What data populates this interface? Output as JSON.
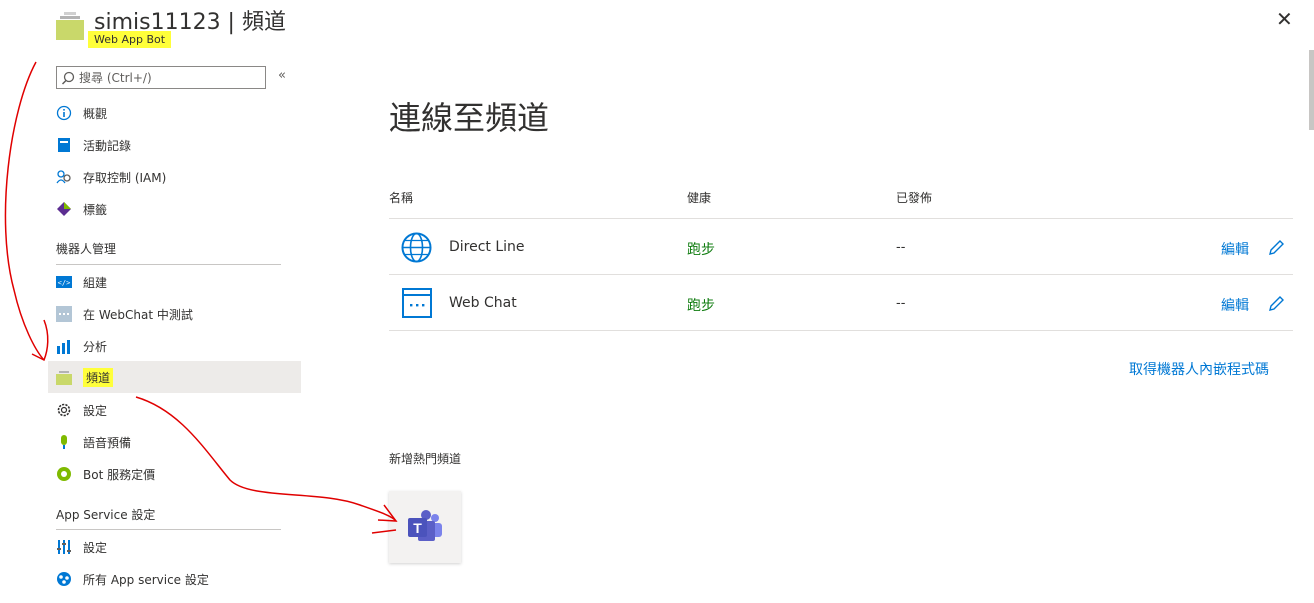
{
  "header": {
    "title": "simis11123 | 頻道",
    "subtitle": "Web App Bot",
    "close_icon": "close-icon"
  },
  "sidebar": {
    "search_placeholder": "搜尋 (Ctrl+/)",
    "collapse_label": "«",
    "items_top": [
      {
        "label": "概觀",
        "icon": "info-icon"
      },
      {
        "label": "活動記錄",
        "icon": "activity-log-icon"
      },
      {
        "label": "存取控制 (IAM)",
        "icon": "people-icon"
      },
      {
        "label": "標籤",
        "icon": "tag-icon"
      }
    ],
    "section_bot": "機器人管理",
    "items_bot": [
      {
        "label": "組建",
        "icon": "code-icon"
      },
      {
        "label": "在 WebChat 中測試",
        "icon": "webchat-test-icon"
      },
      {
        "label": "分析",
        "icon": "analytics-icon"
      },
      {
        "label": "頻道",
        "icon": "channels-icon"
      },
      {
        "label": "設定",
        "icon": "gear-icon"
      },
      {
        "label": "語音預備",
        "icon": "microphone-icon"
      },
      {
        "label": "Bot 服務定價",
        "icon": "pricing-icon"
      }
    ],
    "section_app": "App Service 設定",
    "items_app": [
      {
        "label": "設定",
        "icon": "sliders-icon"
      },
      {
        "label": "所有 App service 設定",
        "icon": "app-service-icon"
      }
    ]
  },
  "main": {
    "title": "連線至頻道",
    "columns": {
      "name": "名稱",
      "health": "健康",
      "published": "已發佈"
    },
    "channels": [
      {
        "name": "Direct Line",
        "health": "跑步",
        "published": "--",
        "edit": "編輯",
        "icon": "globe-icon"
      },
      {
        "name": "Web Chat",
        "health": "跑步",
        "published": "--",
        "edit": "編輯",
        "icon": "web-chat-icon"
      }
    ],
    "embed_link": "取得機器人內嵌程式碼",
    "popular_label": "新增熱門頻道",
    "popular_channels": [
      {
        "name": "Microsoft Teams",
        "icon": "teams-icon"
      }
    ]
  },
  "colors": {
    "accent": "#0078d4",
    "status_ok": "#107c10",
    "highlight": "#ffff3a",
    "annotation": "#e00000"
  }
}
